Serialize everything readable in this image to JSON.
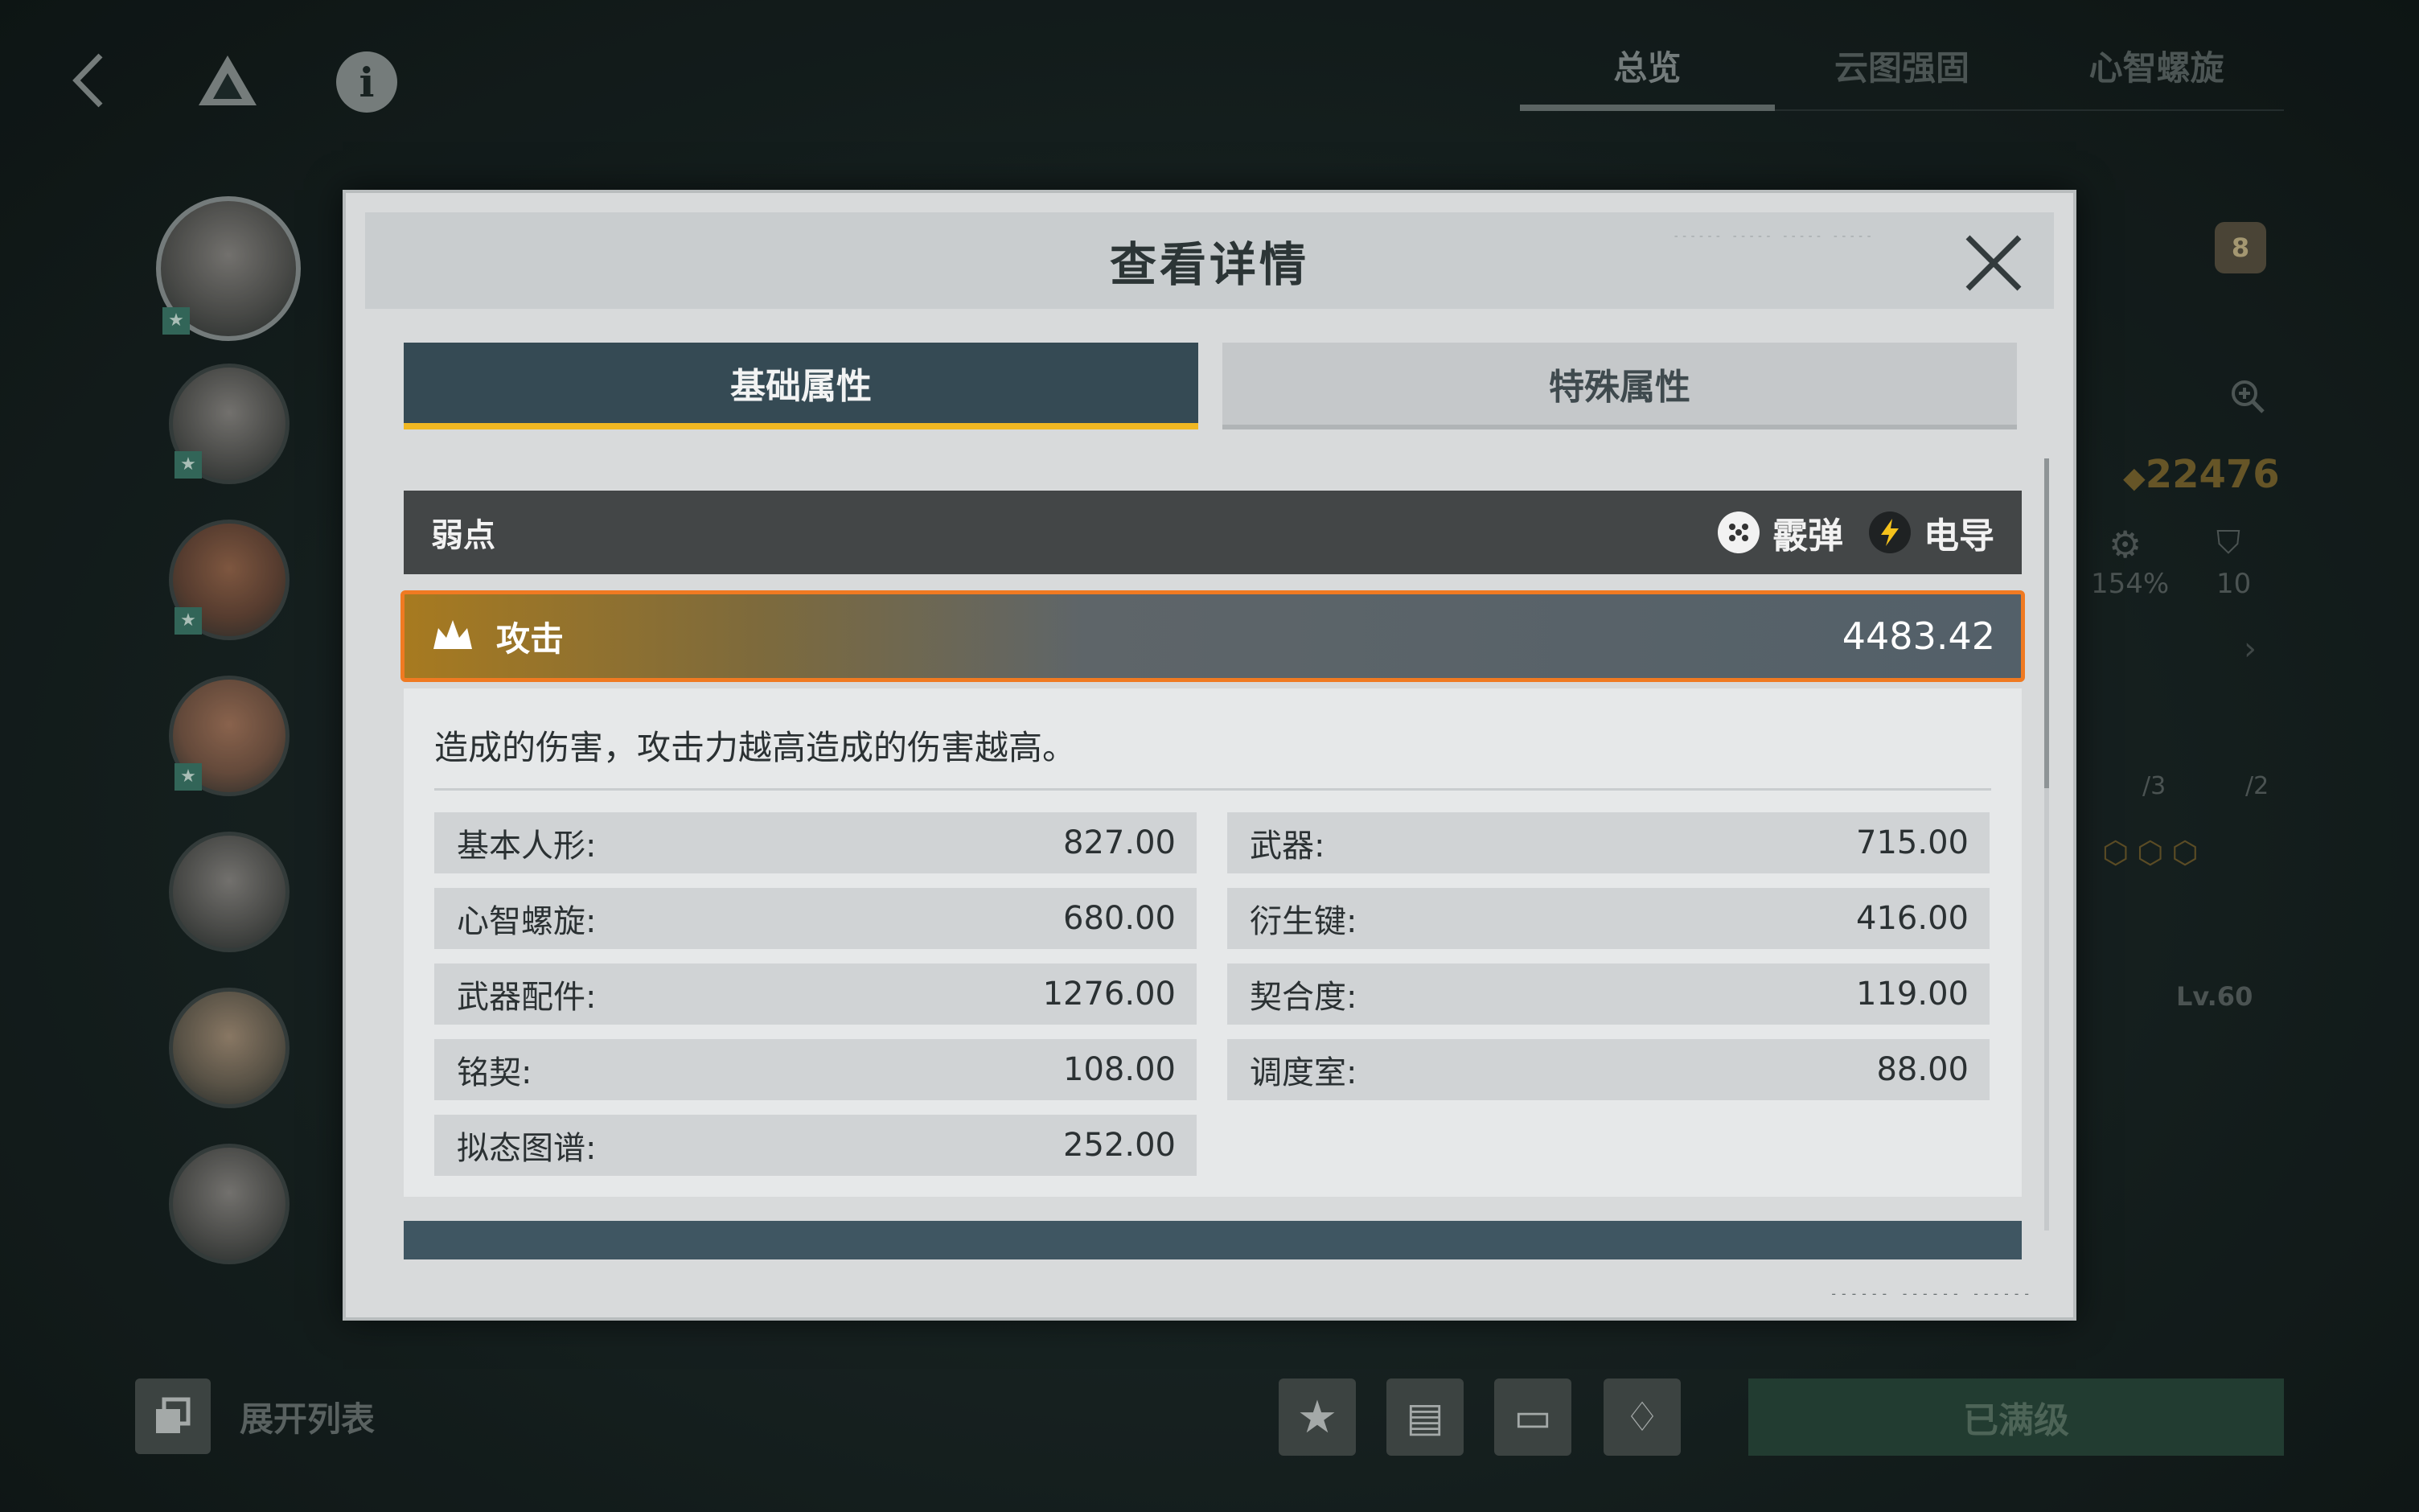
{
  "top_tabs": [
    {
      "label": "总览",
      "active": true
    },
    {
      "label": "云图强固",
      "active": false
    },
    {
      "label": "心智螺旋",
      "active": false
    }
  ],
  "background": {
    "currency_value": "22476",
    "stat_percent": "154%",
    "stat_number": "10",
    "badge_number": "8",
    "slot_a": "/3",
    "slot_b": "/2",
    "level_label": "Lv.60",
    "expand_list_label": "展开列表",
    "max_level_label": "已满级"
  },
  "modal": {
    "title": "查看详情",
    "tabs": [
      {
        "label": "基础属性",
        "active": true
      },
      {
        "label": "特殊属性",
        "active": false
      }
    ],
    "weakness": {
      "label": "弱点",
      "items": [
        {
          "name": "霰弹",
          "icon": "shotgun-icon"
        },
        {
          "name": "电导",
          "icon": "lightning-icon"
        }
      ]
    },
    "attack": {
      "label": "攻击",
      "value": "4483.42",
      "description": "造成的伤害，攻击力越高造成的伤害越高。",
      "breakdown": [
        {
          "label": "基本人形:",
          "value": "827.00"
        },
        {
          "label": "武器:",
          "value": "715.00"
        },
        {
          "label": "心智螺旋:",
          "value": "680.00"
        },
        {
          "label": "衍生键:",
          "value": "416.00"
        },
        {
          "label": "武器配件:",
          "value": "1276.00"
        },
        {
          "label": "契合度:",
          "value": "119.00"
        },
        {
          "label": "铭契:",
          "value": "108.00"
        },
        {
          "label": "调度室:",
          "value": "88.00"
        },
        {
          "label": "拟态图谱:",
          "value": "252.00"
        }
      ]
    }
  },
  "colors": {
    "accent_yellow": "#f0b722",
    "highlight_orange": "#f07a22",
    "tab_active_bg": "#354a54"
  }
}
